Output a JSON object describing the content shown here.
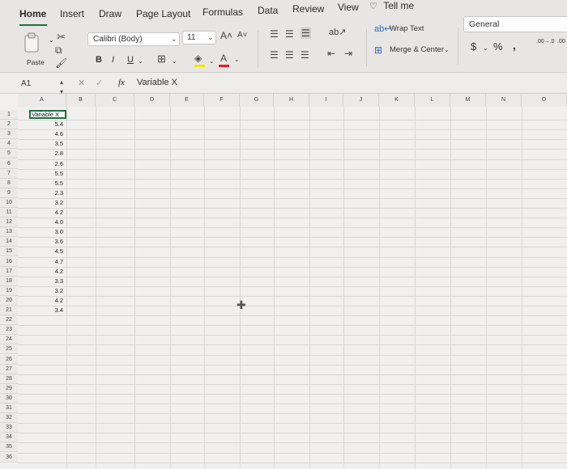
{
  "tabs": [
    {
      "label": "Home",
      "active": true
    },
    {
      "label": "Insert"
    },
    {
      "label": "Draw"
    },
    {
      "label": "Page Layout"
    },
    {
      "label": "Formulas"
    },
    {
      "label": "Data"
    },
    {
      "label": "Review"
    },
    {
      "label": "View"
    },
    {
      "label": "Tell me"
    }
  ],
  "ribbon": {
    "paste_label": "Paste",
    "font_name": "Calibri (Body)",
    "font_size": "11",
    "bold": "B",
    "italic": "I",
    "underline": "U",
    "wrap_text": "Wrap Text",
    "merge_center": "Merge & Center",
    "number_format": "General",
    "currency": "$",
    "percent": "%",
    "comma": ",",
    "inc_decimal": ".00→.0",
    "dec_decimal": ".00"
  },
  "formula_bar": {
    "name_box": "A1",
    "fx": "fx",
    "content": "Variable X"
  },
  "grid": {
    "columns": [
      "A",
      "B",
      "C",
      "D",
      "E",
      "F",
      "G",
      "H",
      "I",
      "J",
      "K",
      "L",
      "M",
      "N",
      "O"
    ],
    "rows": [
      "1",
      "2",
      "3",
      "4",
      "5",
      "6",
      "7",
      "8",
      "9",
      "10",
      "11",
      "12",
      "13",
      "14",
      "15",
      "16",
      "17",
      "18",
      "19",
      "20",
      "21",
      "22",
      "23",
      "24",
      "25",
      "26",
      "27",
      "28",
      "29",
      "30",
      "31",
      "32",
      "33",
      "34",
      "35",
      "36"
    ],
    "header": "Variable X",
    "values": [
      "5.4",
      "4.6",
      "3.5",
      "2.8",
      "2.6",
      "5.5",
      "5.5",
      "2.3",
      "3.2",
      "4.2",
      "4.0",
      "3.0",
      "3.6",
      "4.5",
      "4.7",
      "4.2",
      "3.3",
      "3.2",
      "4.2",
      "3.4"
    ]
  },
  "colors": {
    "accent": "#1e7145",
    "font_color_underline": "#e02020",
    "fill_underline": "#f2e400"
  }
}
